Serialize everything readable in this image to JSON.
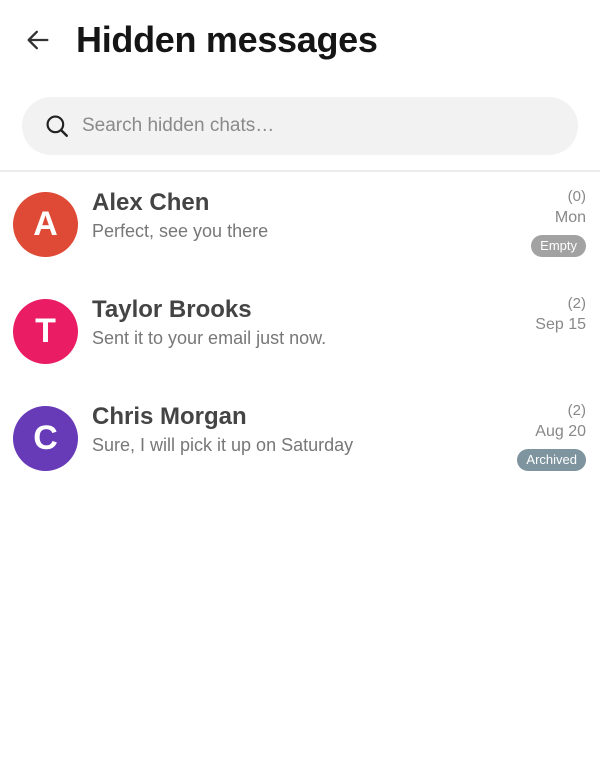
{
  "header": {
    "title": "Hidden messages",
    "back_icon": "arrow-left-icon"
  },
  "search": {
    "placeholder": "Search hidden chats…",
    "value": "",
    "icon": "search-icon"
  },
  "colors": {
    "title": "#151515",
    "name": "#444444",
    "preview": "#777777",
    "meta": "#888888",
    "search_bg": "#f2f2f2"
  },
  "chats": [
    {
      "initial": "A",
      "name": "Alex Chen",
      "preview": "Perfect, see you there",
      "count": "(0)",
      "date": "Mon",
      "badge": "Empty",
      "avatar_color": "#df4a37",
      "badge_color": "#a2a2a2"
    },
    {
      "initial": "T",
      "name": "Taylor Brooks",
      "preview": "Sent it to your email just now.",
      "count": "(2)",
      "date": "Sep 15",
      "badge": "",
      "avatar_color": "#ea1c63",
      "badge_color": ""
    },
    {
      "initial": "C",
      "name": "Chris Morgan",
      "preview": "Sure, I will pick it up on Saturday",
      "count": "(2)",
      "date": "Aug 20",
      "badge": "Archived",
      "avatar_color": "#673ab7",
      "badge_color": "#7e949e"
    }
  ]
}
